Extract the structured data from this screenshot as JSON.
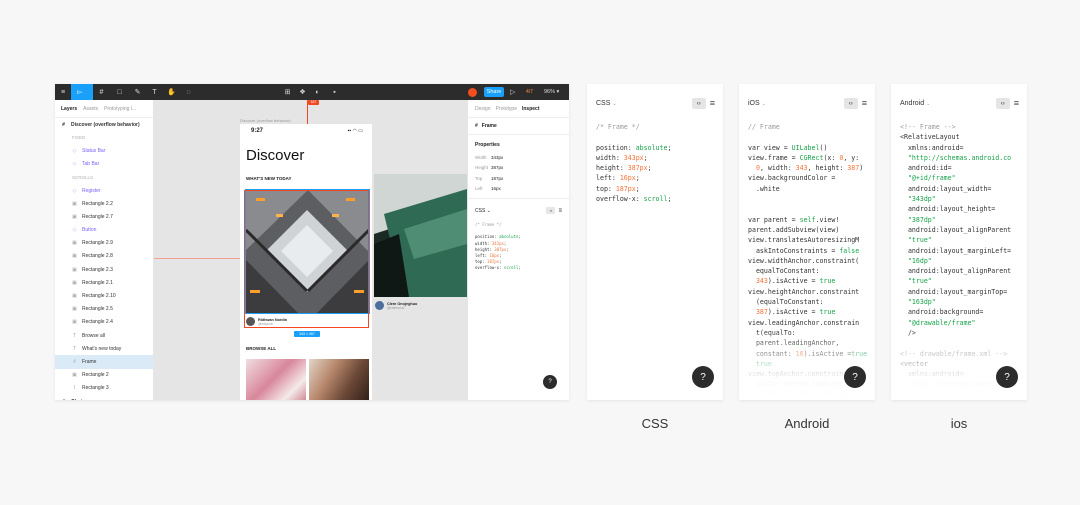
{
  "toolbar": {
    "menu_icon": "≡",
    "move_icon": "▻",
    "frame_icon": "#",
    "shape_icon": "□",
    "pen_icon": "✎",
    "text_icon": "T",
    "hand_icon": "✋",
    "comment_icon": "◌",
    "grid_icon": "⊞",
    "component_icon": "❖",
    "contrast_icon": "◐",
    "boolean_icon": "▪",
    "avatar_letter": "J",
    "share_label": "Share",
    "play_icon": "▷",
    "user_count": "4/7",
    "zoom": "96% ▾"
  },
  "layers_panel": {
    "tabs": [
      "Layers",
      "Assets",
      "Prototyping l..."
    ],
    "rows": [
      {
        "label": "Discover (overflow behavior)",
        "kind": "page",
        "icon": "#"
      },
      {
        "label": "FIXED",
        "kind": "sec",
        "icon": ""
      },
      {
        "label": "Status Bar",
        "kind": "comp",
        "icon": "◇"
      },
      {
        "label": "Tab Bar",
        "kind": "comp",
        "icon": "◇"
      },
      {
        "label": "SCROLLS",
        "kind": "sec",
        "icon": ""
      },
      {
        "label": "Register",
        "kind": "comp",
        "icon": "◇"
      },
      {
        "label": "Rectangle 2.2",
        "kind": "item",
        "icon": "▣"
      },
      {
        "label": "Rectangle 2.7",
        "kind": "item",
        "icon": "▣"
      },
      {
        "label": "Button",
        "kind": "comp",
        "icon": "◇"
      },
      {
        "label": "Rectangle 2.9",
        "kind": "item",
        "icon": "▣"
      },
      {
        "label": "Rectangle 2.8",
        "kind": "item",
        "icon": "▣"
      },
      {
        "label": "Rectangle 2.3",
        "kind": "item",
        "icon": "▣"
      },
      {
        "label": "Rectangle 2.1",
        "kind": "item",
        "icon": "▣"
      },
      {
        "label": "Rectangle 2.10",
        "kind": "item",
        "icon": "▣"
      },
      {
        "label": "Rectangle 2.5",
        "kind": "item",
        "icon": "▣"
      },
      {
        "label": "Rectangle 2.4",
        "kind": "item",
        "icon": "▣"
      },
      {
        "label": "Browse all",
        "kind": "item",
        "icon": "T"
      },
      {
        "label": "What's new today",
        "kind": "item",
        "icon": "T"
      },
      {
        "label": "Frame",
        "kind": "item sel",
        "icon": "#"
      },
      {
        "label": "Rectangle 2",
        "kind": "item",
        "icon": "▣"
      },
      {
        "label": "Rectangle 3",
        "kind": "item",
        "icon": "I"
      },
      {
        "label": "Chats",
        "kind": "page",
        "icon": "#"
      }
    ]
  },
  "canvas": {
    "frame_label": "Discover (overflow behavior)",
    "top_measure": "187",
    "bottom_measure": "343 × 387",
    "phone": {
      "time": "9:27",
      "status_icons": "▪▪ ◠ ▭",
      "title": "Discover",
      "subtitle": "WHAT'S NEW TODAY",
      "author1": {
        "name": "Ridhwan Nordin",
        "handle": "@ridzjcob"
      },
      "author2": {
        "name": "Clem Onojeghuo",
        "handle": "@clemono2"
      },
      "browse": "BROWSE ALL"
    }
  },
  "inspect_panel": {
    "tabs": [
      "Design",
      "Prototype",
      "Inspect"
    ],
    "frame_name": "Frame",
    "properties_title": "Properties",
    "properties": [
      {
        "k": "Width",
        "v": "343px"
      },
      {
        "k": "Height",
        "v": "387px"
      },
      {
        "k": "Top",
        "v": "187px"
      },
      {
        "k": "Left",
        "v": "16px"
      }
    ],
    "code_lang": "CSS ⌄",
    "code_btn": "‹›"
  },
  "cards": [
    {
      "lang": "CSS",
      "caption": "CSS"
    },
    {
      "lang": "iOS",
      "caption": "Android"
    },
    {
      "lang": "Android",
      "caption": "ios"
    }
  ],
  "help_label": "?",
  "code_button": "‹›",
  "list_icon": "≡",
  "chevron": "⌄",
  "colors": {
    "figma_toolbar": "#2c2c2c",
    "figma_blue": "#18a0fb",
    "measure_red": "#f24822",
    "code_keyword": "#17a34a",
    "code_number": "#f2733a",
    "code_comment": "#9a9a9a"
  }
}
